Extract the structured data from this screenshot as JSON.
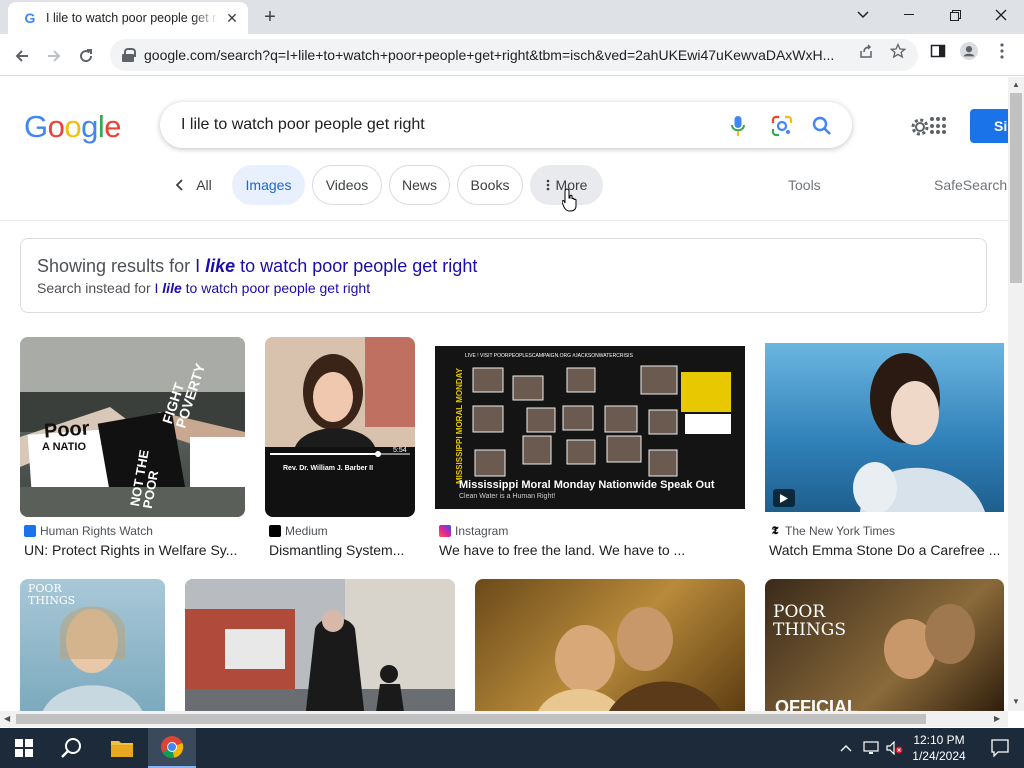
{
  "browser": {
    "tab_title": "I lile to watch poor people get right - Google Search",
    "url": "google.com/search?q=I+lile+to+watch+poor+people+get+right&tbm=isch&ved=2ahUKEwi47uKewvaDAxWxH...",
    "new_tab_label": "+",
    "close_tab_label": "✕"
  },
  "google": {
    "logo_letters": [
      "G",
      "o",
      "o",
      "g",
      "l",
      "e"
    ],
    "logo_colors": [
      "#4285f4",
      "#ea4335",
      "#fbbc05",
      "#4285f4",
      "#34a853",
      "#ea4335"
    ],
    "query": "I lile to watch poor people get right",
    "signin_label": "Si"
  },
  "chips": {
    "all": "All",
    "images": "Images",
    "videos": "Videos",
    "news": "News",
    "books": "Books",
    "more": "More",
    "tools": "Tools",
    "safesearch": "SafeSearch"
  },
  "spelling": {
    "showing_prefix": "Showing results for",
    "showing_pre": "I",
    "showing_corrected": "like",
    "showing_rest": "to watch poor people get right",
    "instead_prefix": "Search instead for",
    "instead_pre": "I",
    "instead_original": "lile",
    "instead_rest": "to watch poor people get right"
  },
  "results": [
    {
      "source": "Human Rights Watch",
      "title": "UN: Protect Rights in Welfare Sy...",
      "fav_color": "#1a73e8"
    },
    {
      "source": "Medium",
      "title": "Dismantling System...",
      "fav_color": "#000000"
    },
    {
      "source": "Instagram",
      "title": "We have to free the land. We have to ...",
      "fav_color": "#e1306c"
    },
    {
      "source": "The New York Times",
      "title": "Watch Emma Stone Do a Carefree ...",
      "fav_color": "#000000"
    }
  ],
  "image_text": {
    "r1_sign_a": "FIGHT POVERTY",
    "r1_sign_b": "NOT THE POOR",
    "r1_banner": "Poor",
    "r1_banner2": "A NATIO",
    "r2_time": "5:54",
    "r2_caption": "Rev. Dr. William J. Barber II",
    "r3_header": "LIVE ! VISIT POORPEOPLESCAMPAIGN.ORG #JACKSONWATERCRISIS",
    "r3_side": "MISSISSIPPI MORAL MONDAY",
    "r3_caption": "Mississippi Moral Monday Nationwide Speak Out",
    "r3_sub": "Clean Water is a Human Right!",
    "r6_title": "POOR THINGS",
    "r8_title": "POOR THINGS",
    "r8_sub": "OFFICIAL"
  },
  "taskbar": {
    "time": "12:10 PM",
    "date": "1/24/2024"
  }
}
